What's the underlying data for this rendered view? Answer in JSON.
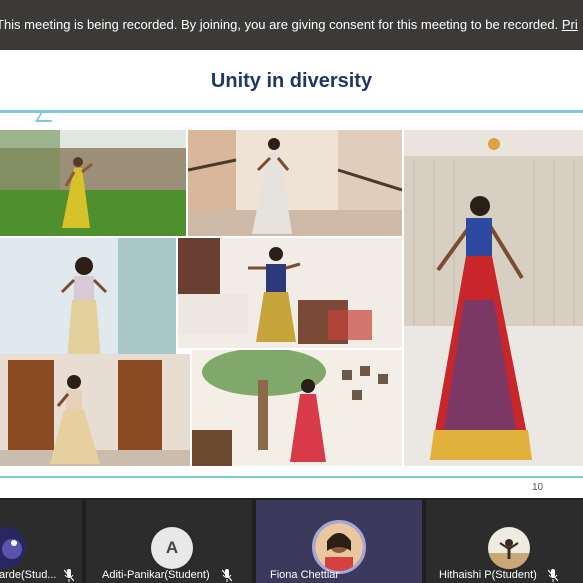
{
  "banner": {
    "text": "This meeting is being recorded. By joining, you are giving consent for this meeting to be recorded.",
    "link": "Pri"
  },
  "slide": {
    "title": "Unity in diversity",
    "page_number": "10"
  },
  "colors": {
    "banner_bg": "#3b3a39",
    "title_color": "#1f3864",
    "accent_rule": "#7ec8d9",
    "active_card": "#3b3a5c",
    "active_ring": "#a6a7dc"
  },
  "participants": [
    {
      "name": "arde(Stud...",
      "avatar": "photo",
      "icon": "muted-mic-icon"
    },
    {
      "name": "Aditi-Panikar(Student)",
      "avatar_letter": "A",
      "icon": "muted-mic-icon"
    },
    {
      "name": "Fiona Chettiar",
      "avatar": "photo",
      "active": true
    },
    {
      "name": "Hithaishi P(Student)",
      "avatar": "photo",
      "icon": "muted-mic-icon"
    }
  ]
}
